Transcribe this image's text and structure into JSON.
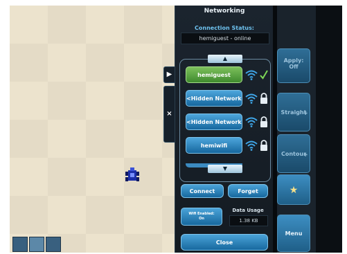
{
  "panel": {
    "title": "Networking",
    "status_label": "Connection Status:",
    "status_value": "hemiguest - online"
  },
  "networks": [
    {
      "name": "hemiguest",
      "status": "connected"
    },
    {
      "name": "<Hidden Network>",
      "status": "locked"
    },
    {
      "name": "<Hidden Network>",
      "status": "locked"
    },
    {
      "name": "hemiwifi",
      "status": "locked"
    }
  ],
  "scroll": {
    "up": "▲",
    "down": "▼"
  },
  "buttons": {
    "connect": "Connect",
    "forget": "Forget",
    "close": "Close"
  },
  "wifi_toggle": {
    "line1": "Wifi Enabled:",
    "line2": "On"
  },
  "data_usage": {
    "label": "Data Usage",
    "value": "1.38 KB"
  },
  "side_tabs": {
    "expand": "▶",
    "close": "×"
  },
  "right_menu": {
    "apply_line1": "Apply:",
    "apply_line2": "Off",
    "straight": "Straight",
    "contour": "Contour",
    "star": "★",
    "menu": "Menu"
  },
  "colors": {
    "accent": "#2a7db5",
    "connected": "#5aa53f",
    "check": "#7ed957"
  },
  "icons": [
    "wifi-icon",
    "lock-icon",
    "check-icon",
    "star-icon",
    "robot-icon",
    "map-icon"
  ]
}
